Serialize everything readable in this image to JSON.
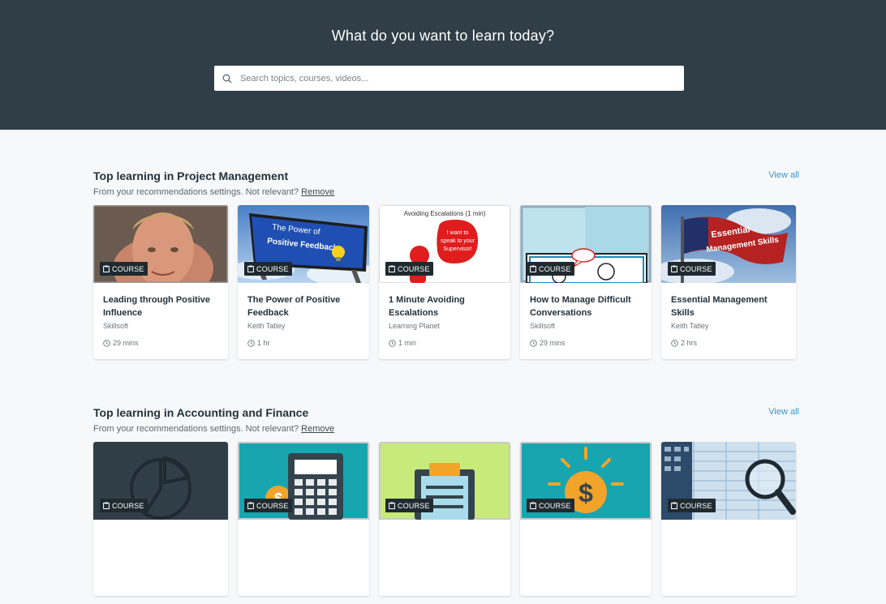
{
  "hero": {
    "title": "What do you want to learn today?",
    "search_placeholder": "Search topics, courses, videos...",
    "bg_color": "#2f3e47"
  },
  "sections": [
    {
      "title": "Top learning in Project Management",
      "subtitle": "From your recommendations settings. Not relevant?",
      "remove_label": "Remove",
      "view_all_label": "View all",
      "cards": [
        {
          "type": "COURSE",
          "title": "Leading through Positive Influence",
          "author": "Skillsoft",
          "duration": "29 mins"
        },
        {
          "type": "COURSE",
          "title": "The Power of Positive Feedback",
          "author": "Keith Tatley",
          "duration": "1 hr",
          "thumb_text_1": "The Power of",
          "thumb_text_2": "Positive Feedback"
        },
        {
          "type": "COURSE",
          "title": "1 Minute Avoiding Escalations",
          "author": "Learning Planet",
          "duration": "1 min",
          "thumb_text_1": "Avoiding Escalations (1 min)",
          "thumb_text_2": "I want to",
          "thumb_text_3": "speak to your",
          "thumb_text_4": "Supervisor!"
        },
        {
          "type": "COURSE",
          "title": "How to Manage Difficult Conversations",
          "author": "Skillsoft",
          "duration": "29 mins"
        },
        {
          "type": "COURSE",
          "title": "Essential Management Skills",
          "author": "Keith Tatley",
          "duration": "2 hrs",
          "thumb_text_1": "Essential",
          "thumb_text_2": "Management Skills"
        }
      ]
    },
    {
      "title": "Top learning in Accounting and Finance",
      "subtitle": "From your recommendations settings. Not relevant?",
      "remove_label": "Remove",
      "view_all_label": "View all",
      "cards": [
        {
          "type": "COURSE"
        },
        {
          "type": "COURSE"
        },
        {
          "type": "COURSE"
        },
        {
          "type": "COURSE"
        },
        {
          "type": "COURSE"
        }
      ]
    }
  ],
  "colors": {
    "accent": "#3597c8",
    "badge": "#1f2a30",
    "teal": "#17a5b0"
  }
}
